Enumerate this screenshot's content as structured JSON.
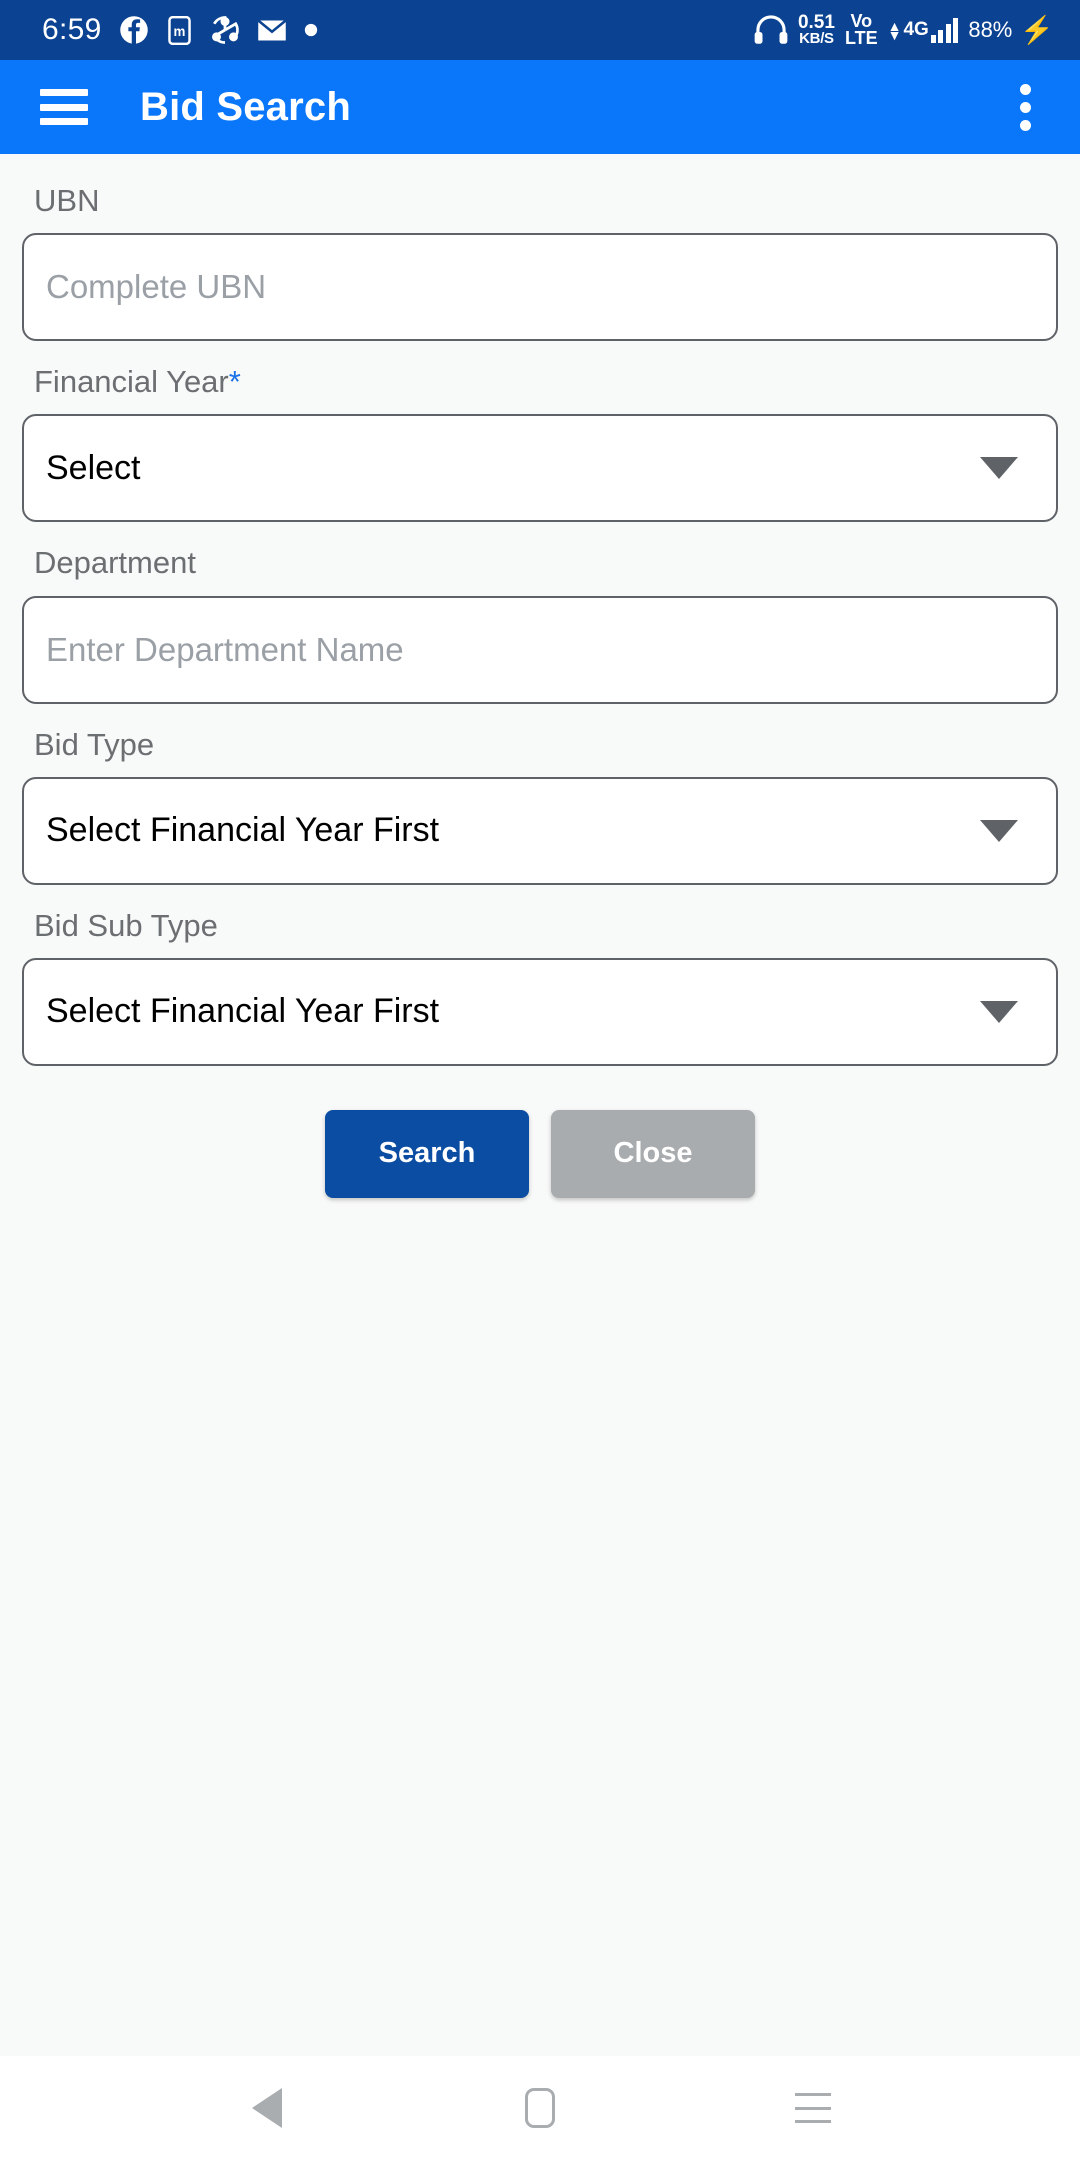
{
  "status_bar": {
    "clock": "6:59",
    "left_icons": [
      "facebook-icon",
      "m-app-icon",
      "sync-icon",
      "mail-icon",
      "dot-icon"
    ],
    "net_speed_value": "0.51",
    "net_speed_unit": "KB/S",
    "volte_top": "Vo",
    "volte_bottom": "LTE",
    "network_type": "4G",
    "battery": "88%",
    "charging_icon": "bolt-icon",
    "background": "#0b4292"
  },
  "app_bar": {
    "menu_icon": "hamburger-menu-icon",
    "title": "Bid Search",
    "overflow_icon": "more-vertical-icon",
    "background": "#0a77fb"
  },
  "form": {
    "ubn": {
      "label": "UBN",
      "placeholder": "Complete UBN",
      "value": ""
    },
    "financial_year": {
      "label": "Financial Year",
      "required_marker": "*",
      "required_color": "#1a73e8",
      "selected": "Select"
    },
    "department": {
      "label": "Department",
      "placeholder": "Enter Department Name",
      "value": ""
    },
    "bid_type": {
      "label": "Bid Type",
      "selected": "Select Financial Year First"
    },
    "bid_sub_type": {
      "label": "Bid Sub Type",
      "selected": "Select Financial Year First"
    },
    "buttons": {
      "search": "Search",
      "search_color": "#0b4da2",
      "close": "Close",
      "close_color": "#a9acae"
    }
  },
  "nav_bar": {
    "back": "back-icon",
    "home": "home-icon",
    "recents": "recents-icon"
  }
}
